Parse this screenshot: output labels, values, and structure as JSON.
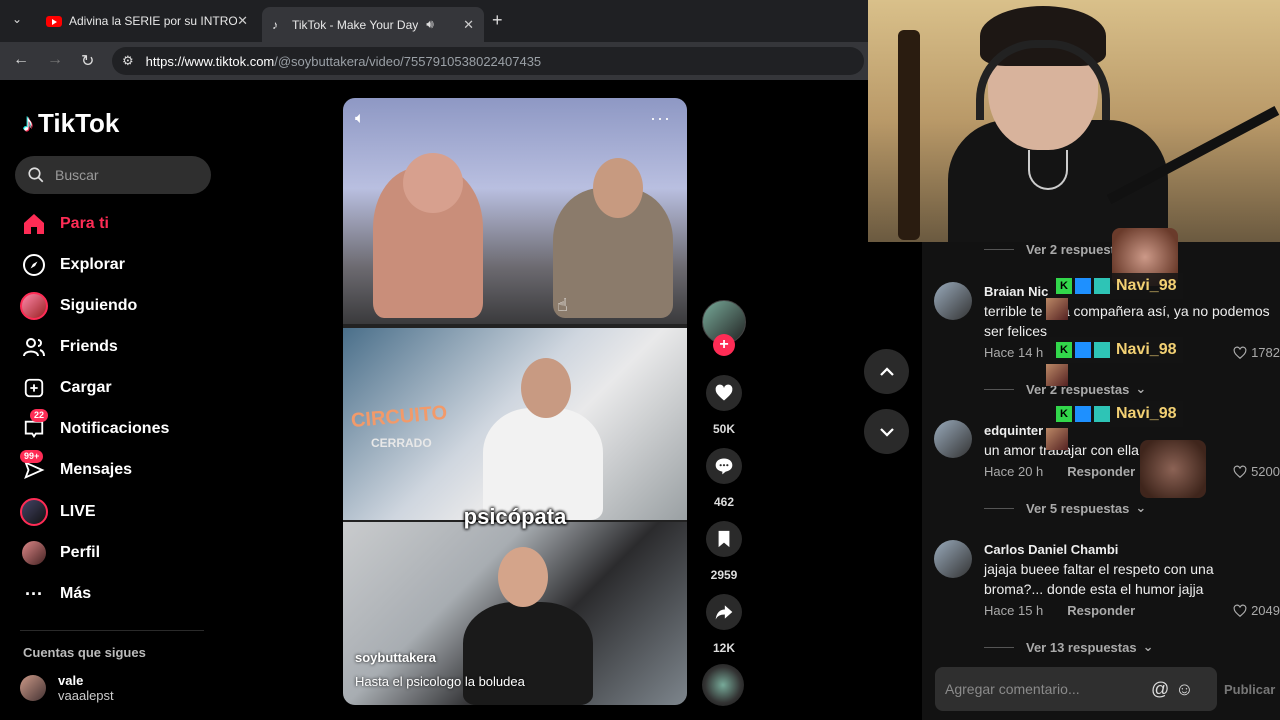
{
  "browser": {
    "tabs": [
      {
        "title": "Adivina la SERIE por su INTRO"
      },
      {
        "title": "TikTok - Make Your Day"
      }
    ],
    "url": {
      "host": "https://www.tiktok.com",
      "path": "/@soybuttakera/video/7557910538022407435"
    }
  },
  "sidebar": {
    "logo": "TikTok",
    "search_placeholder": "Buscar",
    "items": [
      {
        "label": "Para ti",
        "icon": "home-icon"
      },
      {
        "label": "Explorar",
        "icon": "compass-icon"
      },
      {
        "label": "Siguiendo",
        "icon": "following-avatar-icon"
      },
      {
        "label": "Friends",
        "icon": "friends-icon"
      },
      {
        "label": "Cargar",
        "icon": "upload-icon"
      },
      {
        "label": "Notificaciones",
        "icon": "inbox-icon",
        "badge": "22"
      },
      {
        "label": "Mensajes",
        "icon": "messages-icon",
        "badge": "99+"
      },
      {
        "label": "LIVE",
        "icon": "live-avatar-icon"
      },
      {
        "label": "Perfil",
        "icon": "profile-avatar-icon"
      },
      {
        "label": "Más",
        "icon": "more-icon"
      }
    ],
    "following_title": "Cuentas que sigues",
    "account": {
      "name": "vale",
      "handle": "vaaalepst"
    }
  },
  "video": {
    "overlay_top": "CIRCUITO",
    "overlay_sub": "CERRADO",
    "caption": "psicópata",
    "author": "soybuttakera",
    "description": "Hasta el psicologo la boludea"
  },
  "actions": {
    "likes": "50K",
    "comments": "462",
    "saves": "2959",
    "shares": "12K"
  },
  "comments": {
    "items": [
      {
        "ver": "Ver 2 respuestas"
      },
      {
        "name": "Braian Nic",
        "text": "terrible te una compañera así, ya no podemos ser felices",
        "time": "Hace 14 h",
        "likes": "1782",
        "ver": "Ver 2 respuestas"
      },
      {
        "name": "edquinter",
        "text": "un amor trabajar con ella",
        "time": "Hace 20 h",
        "reply": "Responder",
        "likes": "5200",
        "ver": "Ver 5 respuestas"
      },
      {
        "name": "Carlos Daniel Chambi",
        "text": "jajaja bueee faltar el respeto con una broma?... donde esta el humor jajja",
        "time": "Hace 15 h",
        "reply": "Responder",
        "likes": "2049",
        "ver": "Ver 13 respuestas"
      }
    ],
    "input_placeholder": "Agregar comentario...",
    "publish": "Publicar"
  },
  "overlay": {
    "viewer_name": "Navi_98",
    "k": "K"
  }
}
